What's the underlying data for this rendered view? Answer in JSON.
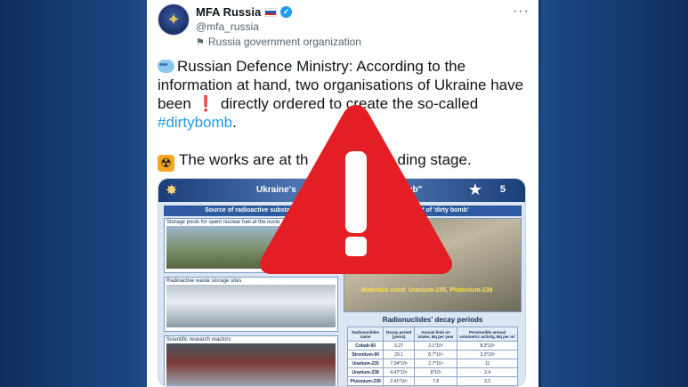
{
  "account": {
    "name": "MFA Russia",
    "handle": "@mfa_russia",
    "organization": "Russia government organization",
    "more_label": "···"
  },
  "tweet": {
    "lines": [
      "Russian Defence Ministry: According to the",
      "information at hand, two organisations of Ukraine have",
      "been",
      "directly ordered to create the so-called",
      "#dirtybomb",
      ".",
      "The works are at th",
      "ding stage."
    ]
  },
  "slide": {
    "title_left": "Ukraine's",
    "title_right": "dirty bomb\"",
    "number": "5",
    "left_header": "Source of radioactive substanc",
    "right_header": "elopment of 'dirty bomb'",
    "panels": [
      "Storage pools for spent nuclear fuel at the nucle",
      "Radioactive waste storage sites",
      "Scientific research reactors"
    ],
    "materials": "Materials used: Uranium-235, Plutonium-239",
    "decay_title": "Radionuclides' decay periods",
    "table": {
      "headers": [
        "Radionuclides name",
        "Decay period (years)",
        "Annual limit on intake, Bq per year",
        "Permissible annual volumetric activity, Bq per m³"
      ],
      "rows": [
        [
          "Cobalt-60",
          "5.27",
          "2.1*10⁵",
          "8.3*10²"
        ],
        [
          "Strontium-90",
          "29.1",
          "8.7*10⁴",
          "3.3*10²"
        ],
        [
          "Uranium-235",
          "7.04*10⁸",
          "2.7*10⁴",
          "11"
        ],
        [
          "Uranium-238",
          "4.47*10⁹",
          "6*10³",
          "2.4"
        ],
        [
          "Plutonium-239",
          "2.41*10⁴",
          "7.8",
          "3.2"
        ]
      ]
    }
  },
  "icons": [
    "speech-balloon-icon",
    "exclamation-icon",
    "radioactive-icon",
    "verified-icon",
    "russia-flag-icon",
    "warning-triangle-icon"
  ],
  "colors": {
    "link": "#1d9bf0",
    "warning_red": "#e31e24",
    "verified": "#1d9bf0"
  }
}
